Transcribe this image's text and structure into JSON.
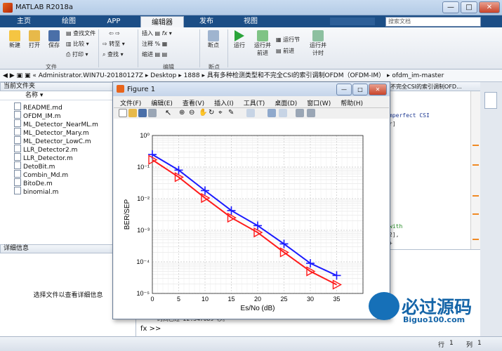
{
  "window": {
    "title": "MATLAB R2018a",
    "controls": [
      "—",
      "□",
      "✕"
    ]
  },
  "tabs": [
    {
      "label": "主页"
    },
    {
      "label": "绘图"
    },
    {
      "label": "APP"
    },
    {
      "label": "编辑器"
    },
    {
      "label": "发布"
    },
    {
      "label": "视图"
    }
  ],
  "search_placeholder": "搜索文档",
  "ribbon": {
    "file_group": {
      "label": "文件",
      "new": "新建",
      "open": "打开",
      "save": "保存",
      "find_files": "查找文件",
      "compare": "比较",
      "print": "打印"
    },
    "nav_group": {
      "goto": "转至",
      "find": "查找"
    },
    "edit_group": {
      "label": "编辑",
      "insert": "插入",
      "comment": "注释",
      "indent": "缩进",
      "fx": "fx"
    },
    "breakpoint_group": {
      "label": "断点",
      "breakpoints": "断点"
    },
    "run_group": {
      "run": "运行",
      "run_advance": "运行并\n前进",
      "run_section": "运行节",
      "advance": "前进",
      "run_time": "运行并\n计时"
    }
  },
  "address": {
    "parts": [
      "«",
      "Administrator.WIN7U-20180127Z",
      "▸",
      "Desktop",
      "▸",
      "1888",
      "▸",
      "具有多种检测类型和不完全CSI的索引调制OFDM（OFDM-IM）",
      "▸",
      "ofdm_im-master"
    ]
  },
  "current_folder": {
    "title": "当前文件夹",
    "col_name": "名称",
    "files": [
      "README.md",
      "OFDM_IM.m",
      "ML_Detector_NearML.m",
      "ML_Detector_Mary.m",
      "ML_Detector_LowC.m",
      "LLR_Detector2.m",
      "LLR_Detector.m",
      "DetoBit.m",
      "Combin_Md.m",
      "BitoDe.m",
      "binomial.m"
    ]
  },
  "details": {
    "title": "详细信息",
    "hint": "选择文件以查看详细信息"
  },
  "editor_tab_title": "不完全CSI的索引调制OFD...",
  "code_snippets": [
    "mperfect CSI",
    "r]",
    "with",
    "2],",
    "+"
  ],
  "command": {
    "time_text": "时间已过 22.347089 秒。",
    "prompt": "fx >>"
  },
  "status": {
    "row_label": "行",
    "row": "1",
    "col_label": "列",
    "col": "1"
  },
  "figure": {
    "title": "Figure 1",
    "menu": [
      "文件(F)",
      "编辑(E)",
      "查看(V)",
      "插入(I)",
      "工具(T)",
      "桌面(D)",
      "窗口(W)",
      "帮助(H)"
    ]
  },
  "watermark": {
    "cn": "必过源码",
    "url": "Biguo100.com"
  },
  "chart_data": {
    "type": "line",
    "xlabel": "Es/No (dB)",
    "ylabel": "BER/SEP",
    "x": [
      0,
      5,
      10,
      15,
      20,
      25,
      30,
      35
    ],
    "xlim": [
      0,
      40
    ],
    "ylim": [
      1e-05,
      1
    ],
    "yscale": "log",
    "grid": true,
    "xticks": [
      "0",
      "5",
      "10",
      "15",
      "20",
      "25",
      "30",
      "35"
    ],
    "yticks": [
      "10⁰",
      "10⁻¹",
      "10⁻²",
      "10⁻³",
      "10⁻⁴",
      "10⁻⁵"
    ],
    "series": [
      {
        "marker": "+",
        "color": "#1a1aff",
        "values": [
          0.25,
          0.08,
          0.018,
          0.0042,
          0.0014,
          0.00037,
          9e-05,
          3.7e-05
        ]
      },
      {
        "marker": "triangle-right",
        "color": "#ff1a1a",
        "values": [
          0.17,
          0.048,
          0.0105,
          0.0025,
          0.00085,
          0.0002,
          5e-05,
          1.9e-05
        ]
      }
    ]
  }
}
